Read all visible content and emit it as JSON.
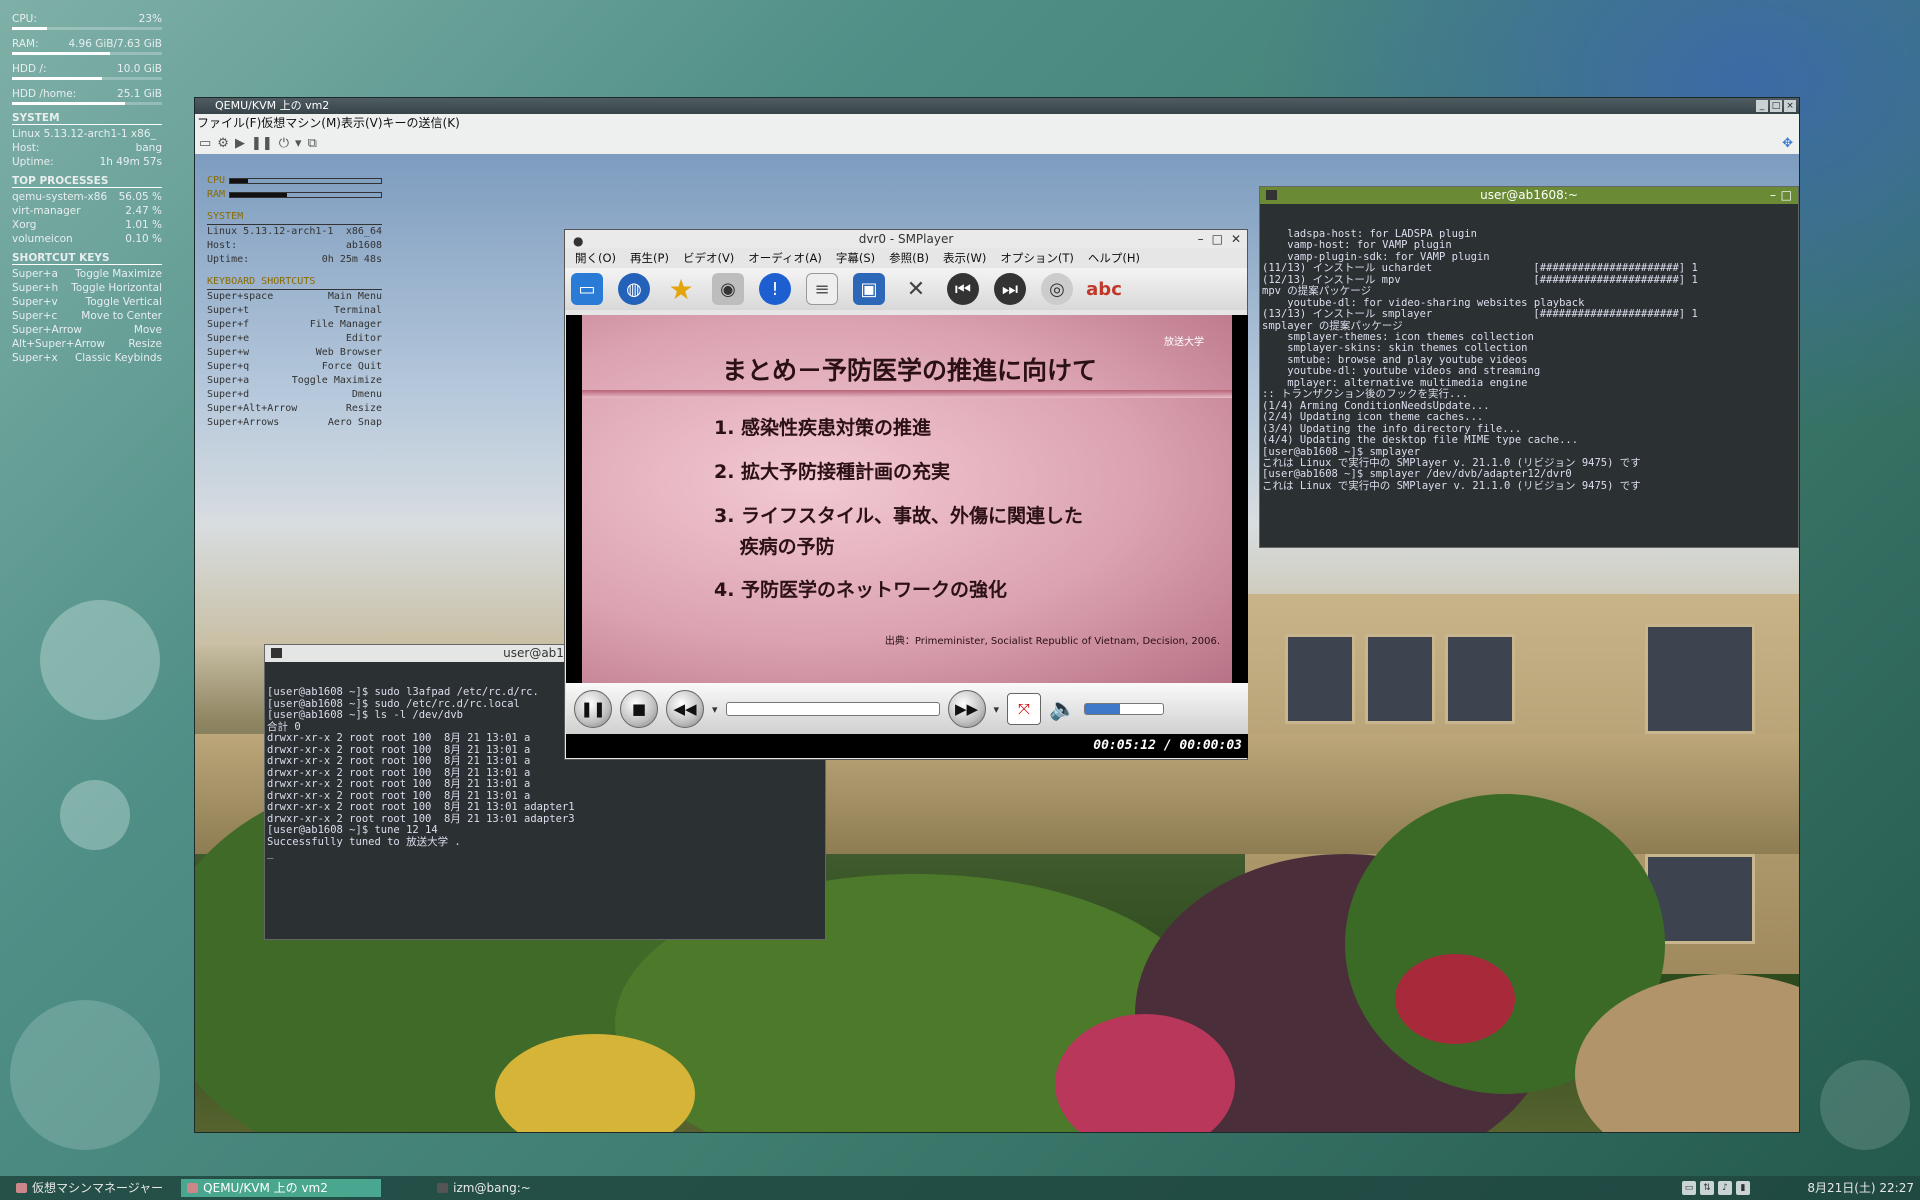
{
  "host_conky": {
    "cpu_label": "CPU:",
    "cpu_value": "23%",
    "cpu_fraction": 0.23,
    "ram_label": "RAM:",
    "ram_value": "4.96 GiB/7.63 GiB",
    "ram_fraction": 0.65,
    "hdd_root_label": "HDD /:",
    "hdd_root_value": "10.0 GiB",
    "hdd_root_fraction": 0.6,
    "hdd_home_label": "HDD /home:",
    "hdd_home_value": "25.1 GiB",
    "hdd_home_fraction": 0.75,
    "system_heading": "SYSTEM",
    "kernel": "Linux 5.13.12-arch1-1 x86_",
    "host_label": "Host:",
    "host_value": "bang",
    "uptime_label": "Uptime:",
    "uptime_value": "1h 49m 57s",
    "top_heading": "TOP PROCESSES",
    "processes": [
      {
        "name": "qemu-system-x86",
        "value": "56.05 %"
      },
      {
        "name": "virt-manager",
        "value": "2.47 %"
      },
      {
        "name": "Xorg",
        "value": "1.01 %"
      },
      {
        "name": "volumeicon",
        "value": "0.10 %"
      }
    ],
    "shortcuts_heading": "SHORTCUT KEYS",
    "shortcuts": [
      {
        "key": "Super+a",
        "action": "Toggle Maximize"
      },
      {
        "key": "Super+h",
        "action": "Toggle Horizontal"
      },
      {
        "key": "Super+v",
        "action": "Toggle Vertical"
      },
      {
        "key": "Super+c",
        "action": "Move to Center"
      },
      {
        "key": "Super+Arrow",
        "action": "Move"
      },
      {
        "key": "Alt+Super+Arrow",
        "action": "Resize"
      },
      {
        "key": "Super+x",
        "action": "Classic Keybinds"
      }
    ]
  },
  "qemu": {
    "title": "QEMU/KVM 上の vm2",
    "menu": "ファイル(F)仮想マシン(M)表示(V)キーの送信(K)"
  },
  "guest_conky": {
    "cpu_label": "CPU",
    "ram_label": "RAM",
    "cpu_fraction": 0.12,
    "ram_fraction": 0.38,
    "system_heading": "SYSTEM",
    "kernel": "Linux 5.13.12-arch1-1",
    "arch": "x86_64",
    "host_label": "Host:",
    "host_value": "ab1608",
    "uptime_label": "Uptime:",
    "uptime_value": "0h 25m 48s",
    "shortcuts_heading": "KEYBOARD SHORTCUTS",
    "shortcuts": [
      {
        "key": "Super+space",
        "action": "Main Menu"
      },
      {
        "key": "Super+t",
        "action": "Terminal"
      },
      {
        "key": "Super+f",
        "action": "File Manager"
      },
      {
        "key": "Super+e",
        "action": "Editor"
      },
      {
        "key": "Super+w",
        "action": "Web Browser"
      },
      {
        "key": "Super+q",
        "action": "Force Quit"
      },
      {
        "key": "Super+a",
        "action": "Toggle Maximize"
      },
      {
        "key": "Super+d",
        "action": "Dmenu"
      },
      {
        "key": "Super+Alt+Arrow",
        "action": "Resize"
      },
      {
        "key": "Super+Arrows",
        "action": "Aero Snap"
      }
    ]
  },
  "terminal_left": {
    "title": "user@ab1608",
    "lines": [
      "[user@ab1608 ~]$ sudo l3afpad /etc/rc.d/rc.",
      "[user@ab1608 ~]$ sudo /etc/rc.d/rc.local",
      "[user@ab1608 ~]$ ls -l /dev/dvb",
      "合計 0",
      "drwxr-xr-x 2 root root 100  8月 21 13:01 a",
      "drwxr-xr-x 2 root root 100  8月 21 13:01 a",
      "drwxr-xr-x 2 root root 100  8月 21 13:01 a",
      "drwxr-xr-x 2 root root 100  8月 21 13:01 a",
      "drwxr-xr-x 2 root root 100  8月 21 13:01 a",
      "drwxr-xr-x 2 root root 100  8月 21 13:01 a",
      "drwxr-xr-x 2 root root 100  8月 21 13:01 adapter1",
      "drwxr-xr-x 2 root root 100  8月 21 13:01 adapter3",
      "[user@ab1608 ~]$ tune 12 14",
      "Successfully tuned to 放送大学 .",
      "_"
    ]
  },
  "terminal_right": {
    "title": "user@ab1608:~",
    "lines": [
      "    ladspa-host: for LADSPA plugin",
      "    vamp-host: for VAMP plugin",
      "    vamp-plugin-sdk: for VAMP plugin",
      "(11/13) インストール uchardet                [######################] 1",
      "(12/13) インストール mpv                     [######################] 1",
      "mpv の提案パッケージ",
      "    youtube-dl: for video-sharing websites playback",
      "(13/13) インストール smplayer                [######################] 1",
      "smplayer の提案パッケージ",
      "    smplayer-themes: icon themes collection",
      "    smplayer-skins: skin themes collection",
      "    smtube: browse and play youtube videos",
      "    youtube-dl: youtube videos and streaming",
      "    mplayer: alternative multimedia engine",
      ":: トランザクション後のフックを実行...",
      "(1/4) Arming ConditionNeedsUpdate...",
      "(2/4) Updating icon theme caches...",
      "(3/4) Updating the info directory file...",
      "(4/4) Updating the desktop file MIME type cache...",
      "[user@ab1608 ~]$ smplayer",
      "これは Linux で実行中の SMPlayer v. 21.1.0 (リビジョン 9475) です",
      "[user@ab1608 ~]$ smplayer /dev/dvb/adapter12/dvr0",
      "これは Linux で実行中の SMPlayer v. 21.1.0 (リビジョン 9475) です"
    ]
  },
  "smplayer": {
    "title": "dvr0 - SMPlayer",
    "menu": [
      "開く(O)",
      "再生(P)",
      "ビデオ(V)",
      "オーディオ(A)",
      "字幕(S)",
      "参照(B)",
      "表示(W)",
      "オプション(T)",
      "ヘルプ(H)"
    ],
    "slide_title": "まとめ－予防医学の推進に向けて",
    "slide_items": [
      "1. 感染性疾患対策の推進",
      "2. 拡大予防接種計画の充実",
      "3. ライフスタイル、事故、外傷に関連した",
      "　 疾病の予防",
      "4. 予防医学のネットワークの強化"
    ],
    "slide_source": "出典：Primeminister, Socialist Republic of Vietnam, Decision, 2006.",
    "slide_logo": "放送大学",
    "time": "00:05:12 / 00:00:03",
    "volume_fraction": 0.45
  },
  "taskbar": {
    "items": [
      "仮想マシンマネージャー",
      "QEMU/KVM 上の vm2",
      "izm@bang:~"
    ],
    "clock": "8月21日(土) 22:27"
  }
}
